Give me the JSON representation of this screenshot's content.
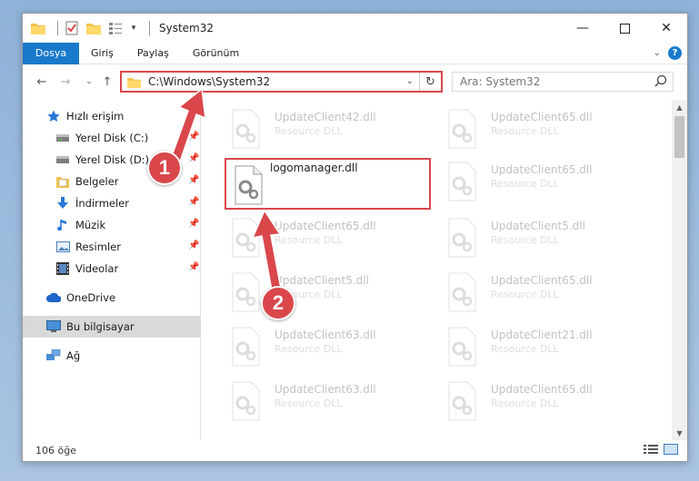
{
  "window": {
    "title": "System32"
  },
  "ribbon": {
    "tabs": [
      "Dosya",
      "Giriş",
      "Paylaş",
      "Görünüm"
    ]
  },
  "address": {
    "path": "C:\\Windows\\System32"
  },
  "search": {
    "placeholder": "Ara: System32"
  },
  "sidebar": {
    "items": [
      {
        "label": "Hızlı erişim",
        "icon": "star-icon",
        "pinned": false
      },
      {
        "label": "Yerel Disk (C:)",
        "icon": "drive-icon",
        "pinned": true
      },
      {
        "label": "Yerel Disk (D:)",
        "icon": "drive-icon",
        "pinned": true
      },
      {
        "label": "Belgeler",
        "icon": "documents-icon",
        "pinned": true
      },
      {
        "label": "İndirmeler",
        "icon": "download-icon",
        "pinned": true
      },
      {
        "label": "Müzik",
        "icon": "music-icon",
        "pinned": true
      },
      {
        "label": "Resimler",
        "icon": "pictures-icon",
        "pinned": true
      },
      {
        "label": "Videolar",
        "icon": "video-icon",
        "pinned": true
      },
      {
        "label": "OneDrive",
        "icon": "cloud-icon",
        "pinned": false
      },
      {
        "label": "Bu bilgisayar",
        "icon": "computer-icon",
        "pinned": false,
        "selected": true
      },
      {
        "label": "Ağ",
        "icon": "network-icon",
        "pinned": false
      }
    ]
  },
  "files": {
    "highlighted": {
      "name": "logomanager.dll",
      "type": ""
    },
    "ghosts": [
      {
        "name": "UpdateClient42.dll",
        "type": "Resource DLL"
      },
      {
        "name": "UpdateClient65.dll",
        "type": "Resource DLL"
      },
      {
        "name": "UpdateClient65.dll",
        "type": "Resource DLL"
      },
      {
        "name": "UpdateClient65.dll",
        "type": "Resource DLL"
      },
      {
        "name": "UpdateClient5.dll",
        "type": "Resource DLL"
      },
      {
        "name": "UpdateClient5.dll",
        "type": "Resource DLL"
      },
      {
        "name": "UpdateClient65.dll",
        "type": "Resource DLL"
      },
      {
        "name": "UpdateClient63.dll",
        "type": "Resource DLL"
      },
      {
        "name": "UpdateClient21.dll",
        "type": "Resource DLL"
      },
      {
        "name": "UpdateClient63.dll",
        "type": "Resource DLL"
      },
      {
        "name": "UpdateClient65.dll",
        "type": "Resource DLL"
      }
    ]
  },
  "status": {
    "count": "106 öğe"
  },
  "annotations": {
    "step1": "1",
    "step2": "2"
  },
  "colors": {
    "accent": "#1979ca",
    "annotation": "#d9474b"
  }
}
